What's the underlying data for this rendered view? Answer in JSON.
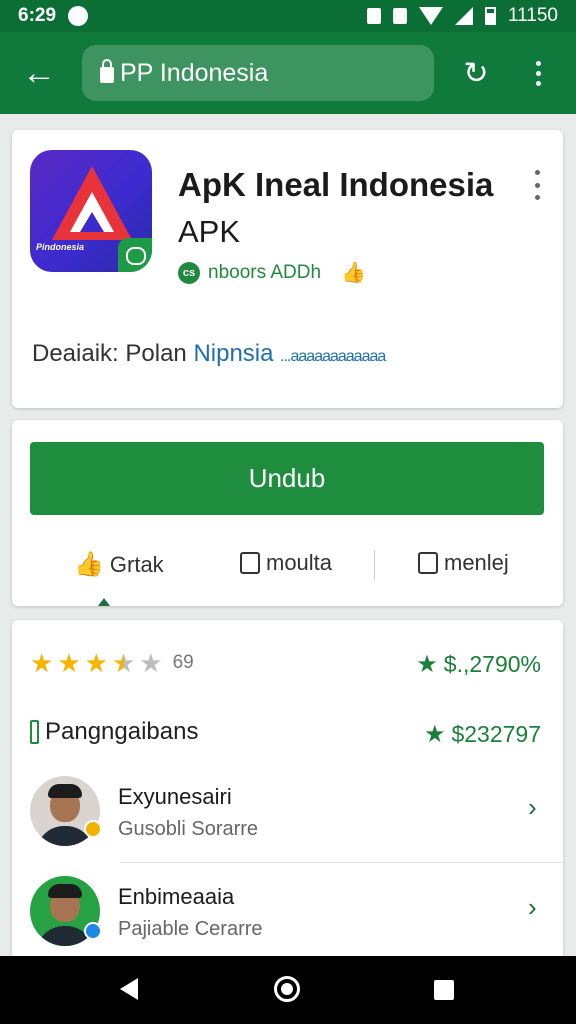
{
  "status_bar": {
    "time": "6:29",
    "battery_text": "11150"
  },
  "browser": {
    "url": "PP Indonesia"
  },
  "app": {
    "title": "ApK Ineal Indonesia",
    "subtitle": "APK",
    "icon_badge_text": "Pindonesia",
    "developer": "nboors ADDh",
    "developer_icon_text": "cs",
    "description_prefix": "Deaiaik: Polan ",
    "description_highlight": "Nipnsia",
    "description_link": "...aaaaaaaaaaaa"
  },
  "download": {
    "button_label": "Undub",
    "actions": [
      {
        "label": "Grtak"
      },
      {
        "label": "moulta"
      },
      {
        "label": "menlej"
      }
    ]
  },
  "reviews": {
    "rating": 3.5,
    "rating_max": 5,
    "rating_count": "69",
    "stat_1": "$.,2790%",
    "stat_2": "$232797",
    "section_title": "Pangngaibans",
    "items": [
      {
        "name": "Exyunesairi",
        "sub": "Gusobli Sorarre"
      },
      {
        "name": "Enbimeaaia",
        "sub": "Pajiable Cerarre"
      }
    ]
  },
  "colors": {
    "status_bar": "#0b6e35",
    "app_bar": "#0f7a3c",
    "primary_button": "#1e8e3e",
    "accent_green": "#1a7f38",
    "star": "#f4b400",
    "link": "#1f6fb0"
  },
  "icons": {
    "back": "arrow-left-icon",
    "lock": "lock-icon",
    "reload": "reload-icon",
    "menu": "more-vert-icon",
    "like": "thumb-up-icon",
    "verified": "verified-icon",
    "chevron": "chevron-right-icon"
  }
}
